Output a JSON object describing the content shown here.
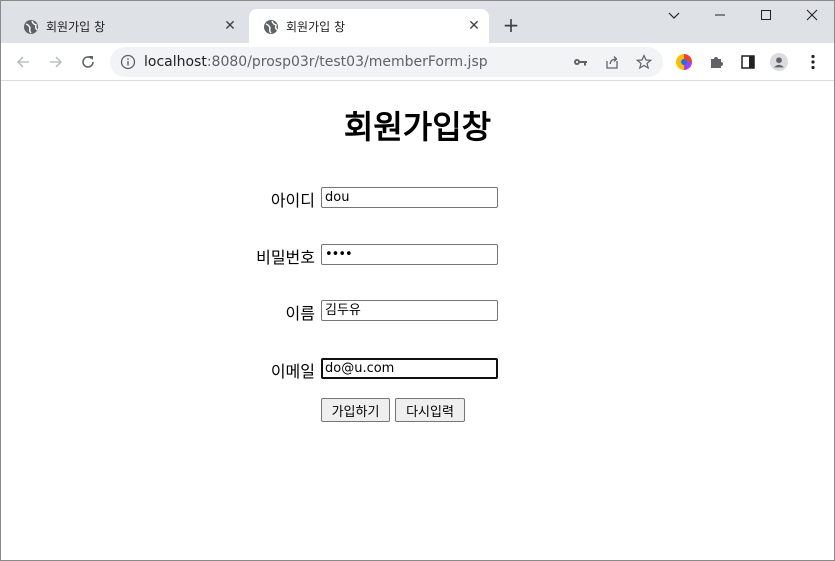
{
  "browser": {
    "tabs": [
      {
        "title": "회원가입 창",
        "active": false
      },
      {
        "title": "회원가입 창",
        "active": true
      }
    ],
    "address": {
      "host": "localhost",
      "path": ":8080/prosp03r/test03/memberForm.jsp"
    }
  },
  "page": {
    "title": "회원가입창",
    "fields": [
      {
        "label": "아이디",
        "value": "dou"
      },
      {
        "label": "비밀번호",
        "value": "••••"
      },
      {
        "label": "이름",
        "value": "김두유"
      },
      {
        "label": "이메일",
        "value": "do@u.com"
      }
    ],
    "submit_label": "가입하기",
    "reset_label": "다시입력"
  },
  "colors": {
    "tabstrip": "#dee1e6",
    "omnibox": "#f1f3f4"
  }
}
